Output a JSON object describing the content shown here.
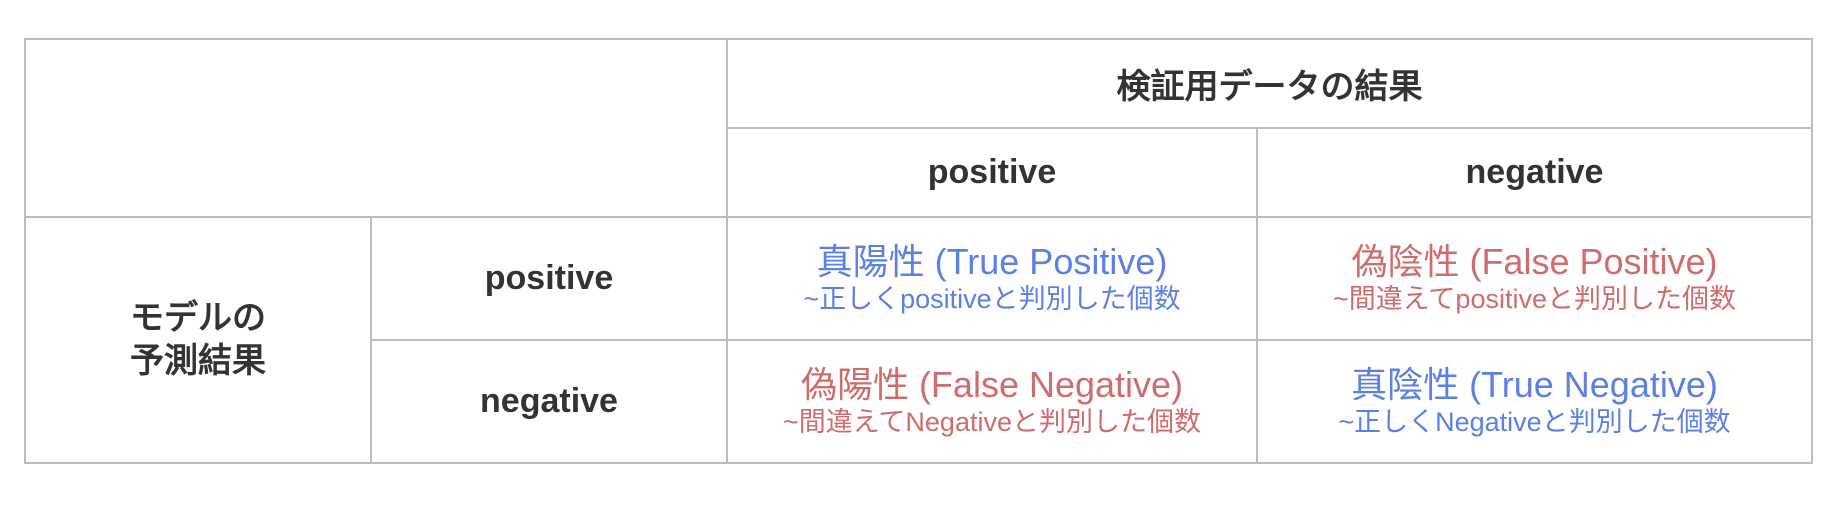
{
  "header": {
    "group_title": "検証用データの結果",
    "col_positive": "positive",
    "col_negative": "negative"
  },
  "side": {
    "line1": "モデルの",
    "line2": "予測結果",
    "row_positive": "positive",
    "row_negative": "negative"
  },
  "cells": {
    "tp": {
      "title": "真陽性 (True Positive)",
      "desc": "~正しくpositiveと判別した個数"
    },
    "fp": {
      "title": "偽陰性 (False Positive)",
      "desc": "~間違えてpositiveと判別した個数"
    },
    "fn": {
      "title": "偽陽性 (False Negative)",
      "desc": "~間違えてNegativeと判別した個数"
    },
    "tn": {
      "title": "真陰性 (True Negative)",
      "desc": "~正しくNegativeと判別した個数"
    }
  },
  "colors": {
    "correct": "#5b80e6",
    "error": "#d06c6c",
    "border": "#bdbdbd",
    "text": "#333333"
  }
}
